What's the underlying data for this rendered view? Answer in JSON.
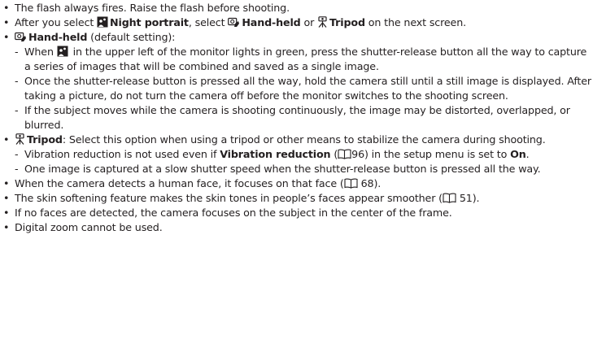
{
  "bullets": {
    "b1": "The flash always fires. Raise the flash before shooting.",
    "b2": {
      "t1": "After you select ",
      "night_portrait": "Night portrait",
      "t2": ", select ",
      "hand_held": "Hand-held",
      "t3": " or ",
      "tripod": "Tripod",
      "t4": " on the next screen."
    },
    "b3": {
      "hand_held": "Hand-held",
      "t1": " (default setting):",
      "s1": {
        "t1": "When ",
        "t2": " in the upper left of the monitor lights in green, press the shutter-release button all the way to capture a series of images that will be combined and saved as a single image."
      },
      "s2": "Once the shutter-release button is pressed all the way, hold the camera still until a still image is displayed. After taking a picture, do not turn the camera off before the monitor switches to the shooting screen.",
      "s3": "If the subject moves while the camera is shooting continuously, the image may be distorted, overlapped, or blurred."
    },
    "b4": {
      "tripod": "Tripod",
      "t1": ": Select this option when using a tripod or other means to stabilize the camera during shooting.",
      "s1": {
        "t1": "Vibration reduction is not used even if ",
        "vr": "Vibration reduction",
        "t2": " (",
        "page": "96",
        "t3": ") in the setup menu is set to ",
        "on": "On",
        "t4": "."
      },
      "s2": "One image is captured at a slow shutter speed when the shutter-release button is pressed all the way."
    },
    "b5": {
      "t1": "When the camera detects a human face, it focuses on that face (",
      "page": "68",
      "t2": ")."
    },
    "b6": {
      "t1": "The skin softening feature makes the skin tones in people’s faces appear smoother (",
      "page": "51",
      "t2": ")."
    },
    "b7": "If no faces are detected, the camera focuses on the subject in the center of the frame.",
    "b8": "Digital zoom cannot be used."
  },
  "symbols": {
    "bullet": "•",
    "dash": "-"
  },
  "icons": {
    "night_portrait": "night-portrait-mode-icon",
    "hand_held": "hand-held-icon",
    "tripod": "tripod-icon",
    "page_ref": "book-reference-icon"
  }
}
